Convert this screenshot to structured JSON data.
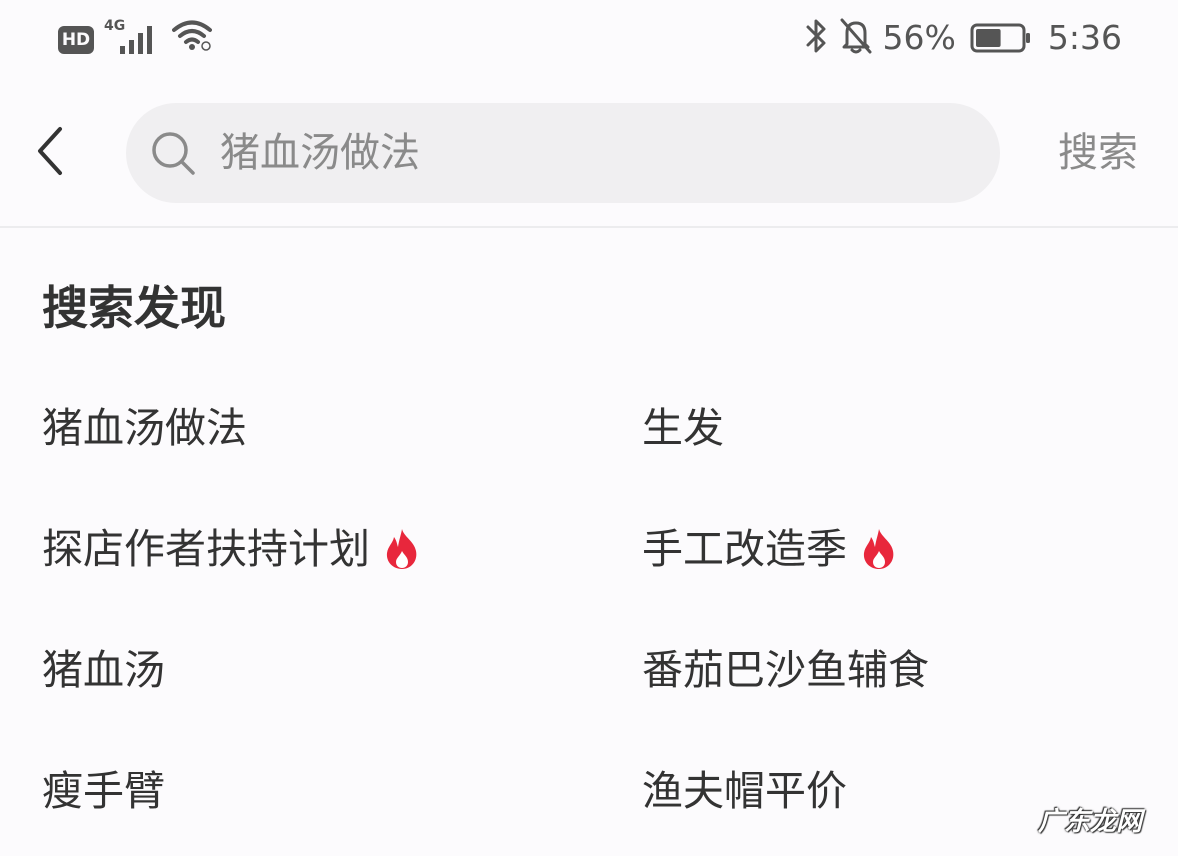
{
  "status_bar": {
    "hd_label": "HD",
    "network_label": "4G",
    "battery_percent": "56%",
    "battery_level": 0.56,
    "time": "5:36",
    "icons": [
      "hd-badge",
      "cell-signal-icon",
      "wifi-icon",
      "bluetooth-icon",
      "bell-off-icon",
      "battery-icon"
    ]
  },
  "search": {
    "query": "猪血汤做法",
    "submit_label": "搜索",
    "icons": [
      "back-arrow-icon",
      "search-icon"
    ]
  },
  "discovery": {
    "title": "搜索发现",
    "items": [
      {
        "label": "猪血汤做法",
        "hot": false
      },
      {
        "label": "生发",
        "hot": false
      },
      {
        "label": "探店作者扶持计划",
        "hot": true
      },
      {
        "label": "手工改造季",
        "hot": true
      },
      {
        "label": "猪血汤",
        "hot": false
      },
      {
        "label": "番茄巴沙鱼辅食",
        "hot": false
      },
      {
        "label": "瘦手臂",
        "hot": false
      },
      {
        "label": "渔夫帽平价",
        "hot": false
      }
    ],
    "hot_icon": "fire-icon",
    "hot_color": "#e8273c"
  },
  "watermark": "广东龙网",
  "colors": {
    "background": "#fcfbfd",
    "search_box": "#f0eff1",
    "text_primary": "#333333",
    "text_muted": "#8a8a8a",
    "hot": "#e8273c"
  }
}
